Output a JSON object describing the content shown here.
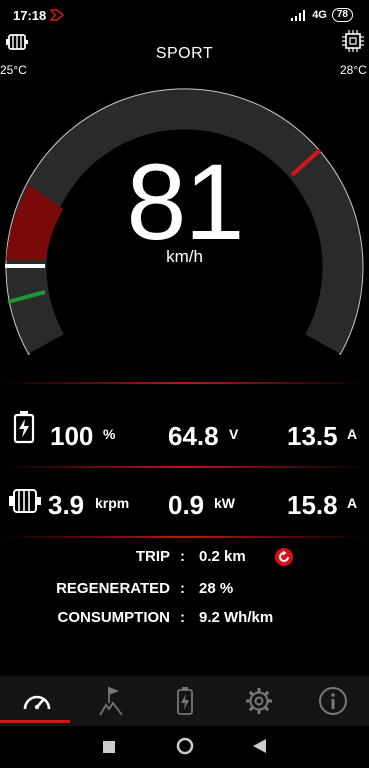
{
  "status": {
    "time": "17:18",
    "network": "4G",
    "battery": "78"
  },
  "mode": "SPORT",
  "temps": {
    "left": "25°C",
    "right": "28°C"
  },
  "speed": {
    "value": "81",
    "unit": "km/h"
  },
  "row1": {
    "battery": {
      "value": "100",
      "unit": "%"
    },
    "voltage": {
      "value": "64.8",
      "unit": "V"
    },
    "current": {
      "value": "13.5",
      "unit": "A"
    }
  },
  "row2": {
    "rpm": {
      "value": "3.9",
      "unit": "krpm"
    },
    "power": {
      "value": "0.9",
      "unit": "kW"
    },
    "current": {
      "value": "15.8",
      "unit": "A"
    }
  },
  "info": {
    "trip": {
      "label": "TRIP",
      "value": "0.2 km"
    },
    "regen": {
      "label": "REGENERATED",
      "value": "28 %"
    },
    "consumption": {
      "label": "CONSUMPTION",
      "value": "9.2 Wh/km"
    }
  },
  "colors": {
    "accent": "#d4141a",
    "regen": "#7a0a0a",
    "green": "#1f9a2f",
    "gauge": "#2a2a2a"
  },
  "nav": [
    "speedometer-icon",
    "route-flag-icon",
    "battery-icon",
    "settings-icon",
    "info-icon"
  ]
}
